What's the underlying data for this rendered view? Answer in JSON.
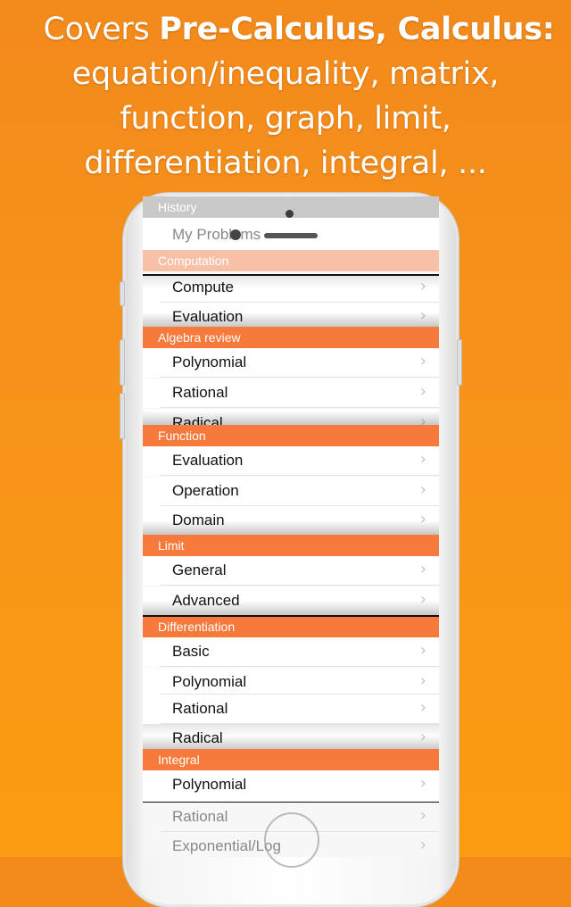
{
  "headline": {
    "line1_prefix": "Covers ",
    "line1_bold": "Pre-Calculus, Calculus:",
    "line2": "equation/inequality, matrix,",
    "line3": "function, graph, limit,",
    "line4": "differentiation, integral, ..."
  },
  "colors": {
    "background": "#f7941a",
    "section_header": "#f77a3c",
    "faded_header": "#f8c0a6",
    "history_header": "#c9c9c9"
  },
  "chevron_glyph": "›",
  "sections": [
    {
      "header": "History",
      "items": [
        "My Problems"
      ]
    },
    {
      "header": "Computation",
      "items": [
        "Compute",
        "Evaluation"
      ]
    },
    {
      "header": "Algebra review",
      "items": [
        "Polynomial",
        "Rational",
        "Radical"
      ]
    },
    {
      "header": "Function",
      "items": [
        "Evaluation",
        "Operation",
        "Domain"
      ]
    },
    {
      "header": "Limit",
      "items": [
        "General",
        "Advanced"
      ]
    },
    {
      "header": "Differentiation",
      "items": [
        "Basic",
        "Polynomial",
        "Rational",
        "Radical"
      ]
    },
    {
      "header": "Integral",
      "items": [
        "Polynomial",
        "Rational",
        "Exponential/Log"
      ]
    }
  ]
}
